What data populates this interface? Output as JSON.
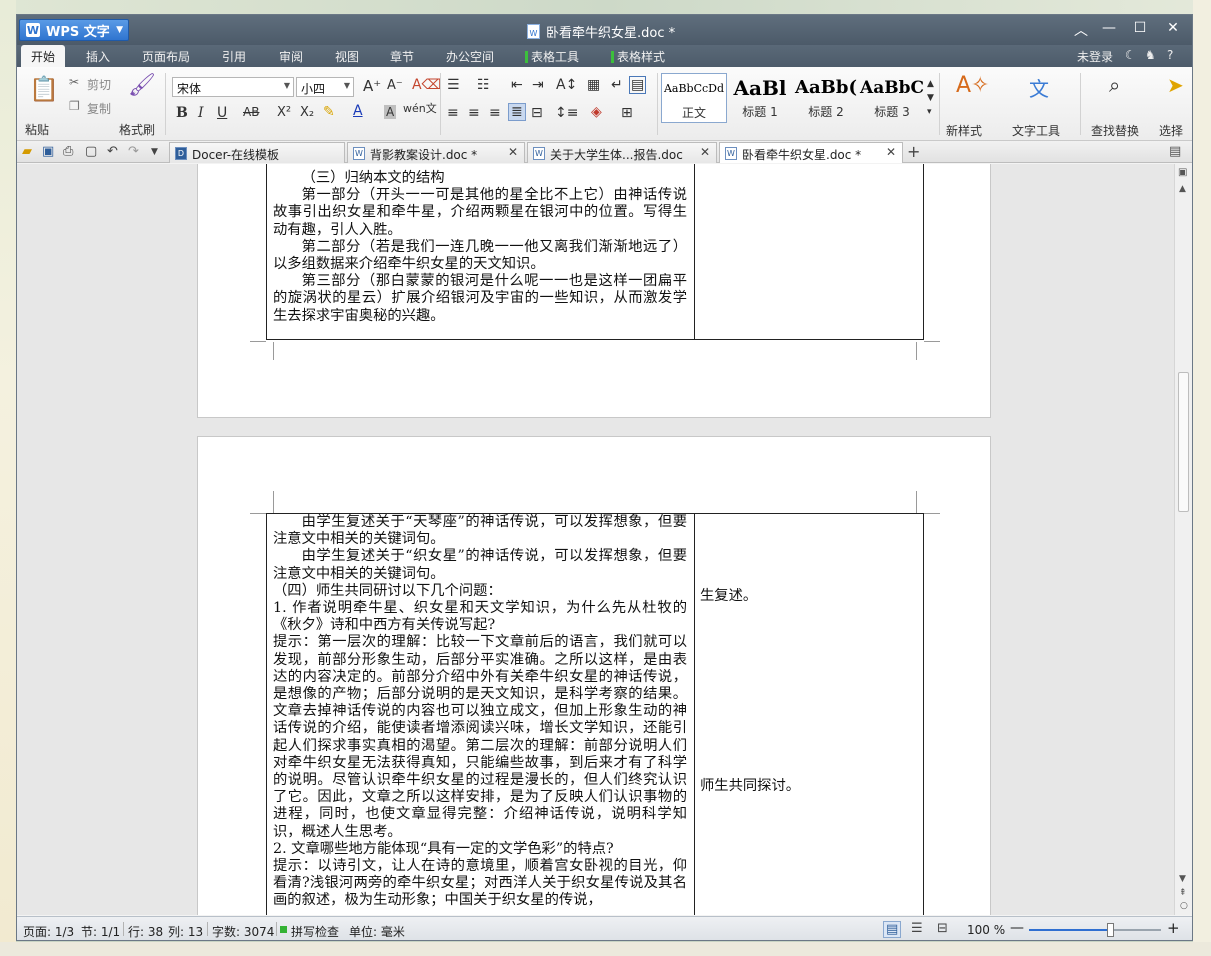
{
  "app": {
    "name": "WPS 文字",
    "doc_title": "卧看牵牛织女星.doc *"
  },
  "menu": {
    "items": [
      "开始",
      "插入",
      "页面布局",
      "引用",
      "审阅",
      "视图",
      "章节",
      "办公空间"
    ],
    "context_tabs": [
      "表格工具",
      "表格样式"
    ],
    "login": "未登录",
    "help": "?"
  },
  "ribbon": {
    "paste": "粘贴",
    "cut": "剪切",
    "copy": "复制",
    "format_painter": "格式刷",
    "font_name": "宋体",
    "font_size": "小四",
    "styles": [
      {
        "sample": "AaBbCcDd",
        "name": "正文"
      },
      {
        "sample": "AaBl",
        "name": "标题 1"
      },
      {
        "sample": "AaBb(",
        "name": "标题 2"
      },
      {
        "sample": "AaBbC",
        "name": "标题 3"
      }
    ],
    "new_style": "新样式",
    "text_tools": "文字工具",
    "find_replace": "查找替换",
    "select": "选择"
  },
  "tabs": [
    {
      "label": "Docer-在线模板"
    },
    {
      "label": "背影教案设计.doc *"
    },
    {
      "label": "关于大学生体...报告.doc"
    },
    {
      "label": "卧看牵牛织女星.doc *"
    }
  ],
  "page1": {
    "lines": [
      "（三）归纳本文的结构",
      "第一部分（开头一一可是其他的星全比不上它）由神话传说故事引出织女星和牵牛星，介绍两颗星在银河中的位置。写得生动有趣，引人入胜。",
      "第二部分（若是我们一连几晚一一他又离我们渐渐地远了）以多组数据来介绍牵牛织女星的天文知识。",
      "第三部分（那白蒙蒙的银河是什么呢一一也是这样一团扁平的旋涡状的星云）扩展介绍银河及宇宙的一些知识，从而激发学生去探求宇宙奥秘的兴趣。"
    ]
  },
  "page2": {
    "paragraphs": [
      "由学生复述关于“天琴座”的神话传说，可以发挥想象，但要注意文中相关的关键词句。",
      "由学生复述关于“织女星”的神话传说，可以发挥想象，但要注意文中相关的关键词句。",
      "（四）师生共同研讨以下几个问题：",
      "1. 作者说明牵牛星、织女星和天文学知识，为什么先从杜牧的《秋夕》诗和中西方有关传说写起?",
      "提示：第一层次的理解：比较一下文章前后的语言，我们就可以发现，前部分形象生动，后部分平实准确。之所以这样，是由表达的内容决定的。前部分介绍中外有关牵牛织女星的神话传说，是想像的产物；后部分说明的是天文知识，是科学考察的结果。文章去掉神话传说的内容也可以独立成文，但加上形象生动的神话传说的介绍，能使读者增添阅读兴味，增长文学知识，还能引起人们探求事实真相的渴望。第二层次的理解：前部分说明人们对牵牛织女星无法获得真知，只能编些故事，到后来才有了科学的说明。尽管认识牵牛织女星的过程是漫长的，但人们终究认识了它。因此，文章之所以这样安排，是为了反映人们认识事物的进程，同时，也使文章显得完整：介绍神话传说，说明科学知识，概述人生思考。",
      "2. 文章哪些地方能体现“具有一定的文学色彩”的特点?",
      "提示：以诗引文，让人在诗的意境里，顺着宫女卧视的目光，仰看清?浅银河两旁的牵牛织女星；对西洋人关于织女星传说及其名画的叙述，极为生动形象；中国关于织女星的传说，"
    ],
    "side_notes": [
      "生复述。",
      "师生共同探讨。"
    ]
  },
  "status": {
    "page": "页面: 1/3",
    "section": "节: 1/1",
    "row": "行: 38",
    "col": "列: 13",
    "words": "字数: 3074",
    "spell": "拼写检查",
    "unit": "单位: 毫米",
    "zoom": "100 %",
    "zoom_level": 0.62
  }
}
